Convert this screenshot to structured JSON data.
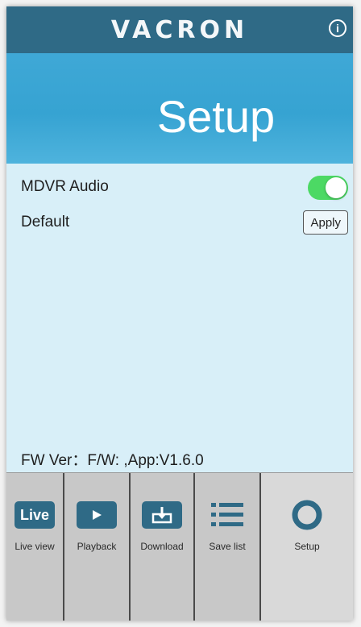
{
  "header": {
    "brand": "VACRON",
    "info_icon": "ⓘ"
  },
  "banner": {
    "title": "Setup"
  },
  "settings": {
    "audio_label": "MDVR Audio",
    "audio_enabled": true,
    "default_label": "Default",
    "apply_label": "Apply"
  },
  "footer": {
    "fw_version": "FW Ver：F/W: ,App:V1.6.0"
  },
  "tabs": [
    {
      "label": "Live view",
      "icon_text": "Live",
      "icon": "live-icon"
    },
    {
      "label": "Playback",
      "icon": "play-icon"
    },
    {
      "label": "Download",
      "icon": "download-icon"
    },
    {
      "label": "Save list",
      "icon": "list-icon"
    },
    {
      "label": "Setup",
      "icon": "gear-icon"
    }
  ],
  "colors": {
    "brand_blue": "#2f6a86",
    "banner_blue": "#3fa8d6",
    "toggle_on": "#4cd964"
  }
}
